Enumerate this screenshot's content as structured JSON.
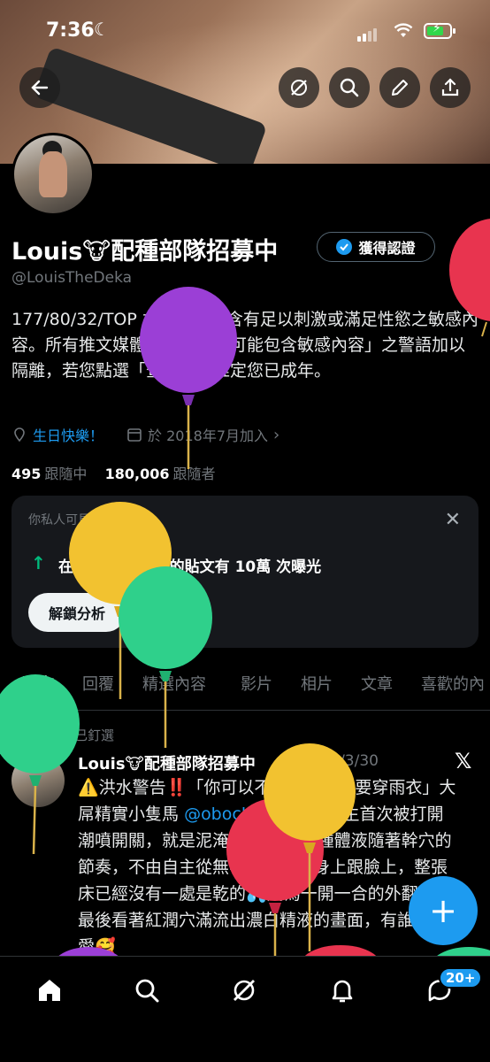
{
  "status_bar": {
    "time": "7:36"
  },
  "profile": {
    "name": "Louis🐮配種部隊招募中",
    "verify_label": "獲得認證",
    "handle": "@LouisTheDeka",
    "bio": "177/80/32/TOP 本帳號可能含有足以刺激或滿足性慾之敏感內容。所有推文媒體均已註記「可能包含敏感內容」之警語加以隔離，若您點選「查看」即推定您已成年。",
    "birthday": "生日快樂！",
    "joined": "於 2018年7月加入",
    "following_count": "495",
    "following_label": "跟隨中",
    "followers_count": "180,006",
    "followers_label": "跟隨者"
  },
  "analytics_card": {
    "title": "你私人可見",
    "text": "在過去 7 天內你的貼文有 10萬 次曝光",
    "button": "解鎖分析"
  },
  "tabs": [
    "貼文",
    "回覆",
    "精選內容",
    "影片",
    "相片",
    "文章",
    "喜歡的內"
  ],
  "pinned_post": {
    "pinned_label": "已釘選",
    "author": "Louis🐮配種部隊招募中",
    "date": "· 2025/3/30",
    "text_start": "⚠️洪水警告‼️「你可以不戴套，但是要穿雨衣」大屌精實小隻馬",
    "mention": "@obock_bot",
    "text_end": "記錄人生首次被打開潮噴開關，就是泥淹成災☔️，各種體液隨著幹穴的節奏，不由自主從無毛大屌噴到身上跟臉上，整張床已經沒有一處是乾的💦成為一開一合的外翻逼，最後看著紅潤穴滿流出濃白精液的畫面，有誰能不愛🥰"
  },
  "nav": {
    "badge": "20+"
  },
  "colors": {
    "accent": "#1d9bf0",
    "background": "#000000",
    "muted": "#71767b",
    "green": "#00ba7c"
  },
  "icons": [
    "back-arrow-icon",
    "grok-icon",
    "search-icon",
    "edit-pencil-icon",
    "share-icon",
    "location-pin-icon",
    "calendar-icon",
    "close-icon",
    "arrow-up-icon",
    "pin-icon",
    "x-logo-icon",
    "plus-icon",
    "home-icon",
    "search-icon",
    "grok-icon",
    "bell-icon",
    "messages-icon"
  ]
}
